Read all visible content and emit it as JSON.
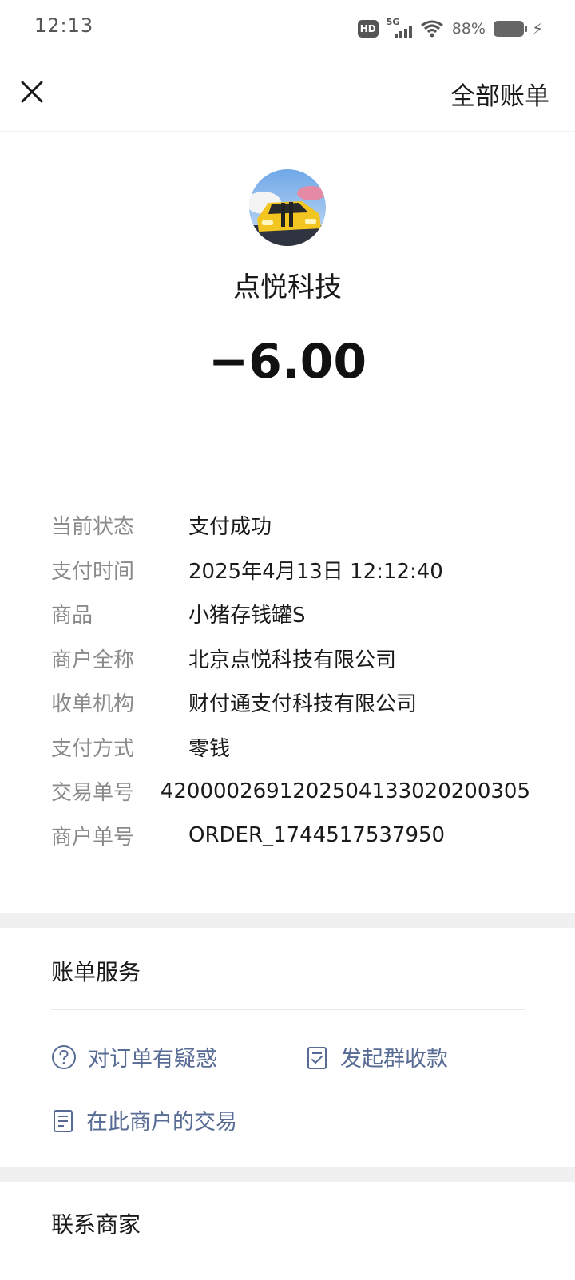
{
  "status_bar": {
    "time": "12:13",
    "hd": "HD",
    "network": "5G",
    "battery_percent": "88%",
    "icons": [
      "hd-icon",
      "signal-icon",
      "wifi-icon",
      "battery-icon",
      "charging-icon"
    ]
  },
  "nav": {
    "close_icon": "close-icon",
    "all_bills_label": "全部账单"
  },
  "merchant": {
    "name": "点悦科技",
    "amount": "−6.00"
  },
  "details": [
    {
      "label": "当前状态",
      "value": "支付成功"
    },
    {
      "label": "支付时间",
      "value": "2025年4月13日 12:12:40"
    },
    {
      "label": "商品",
      "value": "小猪存钱罐S"
    },
    {
      "label": "商户全称",
      "value": "北京点悦科技有限公司"
    },
    {
      "label": "收单机构",
      "value": "财付通支付科技有限公司"
    },
    {
      "label": "支付方式",
      "value": "零钱"
    },
    {
      "label": "交易单号",
      "value": "4200002691202504133020200305"
    },
    {
      "label": "商户单号",
      "value": "ORDER_1744517537950"
    }
  ],
  "bill_services": {
    "title": "账单服务",
    "items": [
      {
        "label": "对订单有疑惑",
        "icon": "question-circle-icon"
      },
      {
        "label": "发起群收款",
        "icon": "checklist-icon"
      },
      {
        "label": "在此商户的交易",
        "icon": "document-icon"
      }
    ]
  },
  "contact": {
    "title": "联系商家"
  },
  "colors": {
    "link": "#576b95",
    "label_gray": "#8a8a8a",
    "section_band": "#f0f0f0"
  }
}
